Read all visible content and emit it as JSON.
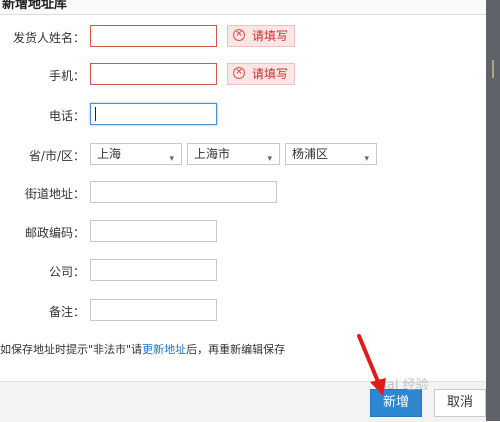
{
  "header": {
    "title": "新增地址库"
  },
  "form": {
    "shipper_name": {
      "label": "发货人姓名：",
      "value": "",
      "error": "请填写"
    },
    "mobile": {
      "label": "手机：",
      "value": "",
      "error": "请填写"
    },
    "phone": {
      "label": "电话：",
      "value": ""
    },
    "region": {
      "label": "省/市/区：",
      "province": "上海",
      "city": "上海市",
      "district": "杨浦区"
    },
    "street": {
      "label": "街道地址：",
      "value": ""
    },
    "postcode": {
      "label": "邮政编码：",
      "value": ""
    },
    "company": {
      "label": "公司：",
      "value": ""
    },
    "note": {
      "label": "备注：",
      "value": ""
    }
  },
  "tip": {
    "prefix": "如保存地址时提示\"非法市\"请",
    "link": "更新地址",
    "suffix": "后，再重新编辑保存"
  },
  "footer": {
    "add_label": "新增",
    "cancel_label": "取消"
  },
  "watermark": {
    "text": "Bai 经验"
  },
  "colors": {
    "error": "#d9534f",
    "primary": "#2e87d3",
    "arrow": "#e01b1b"
  }
}
